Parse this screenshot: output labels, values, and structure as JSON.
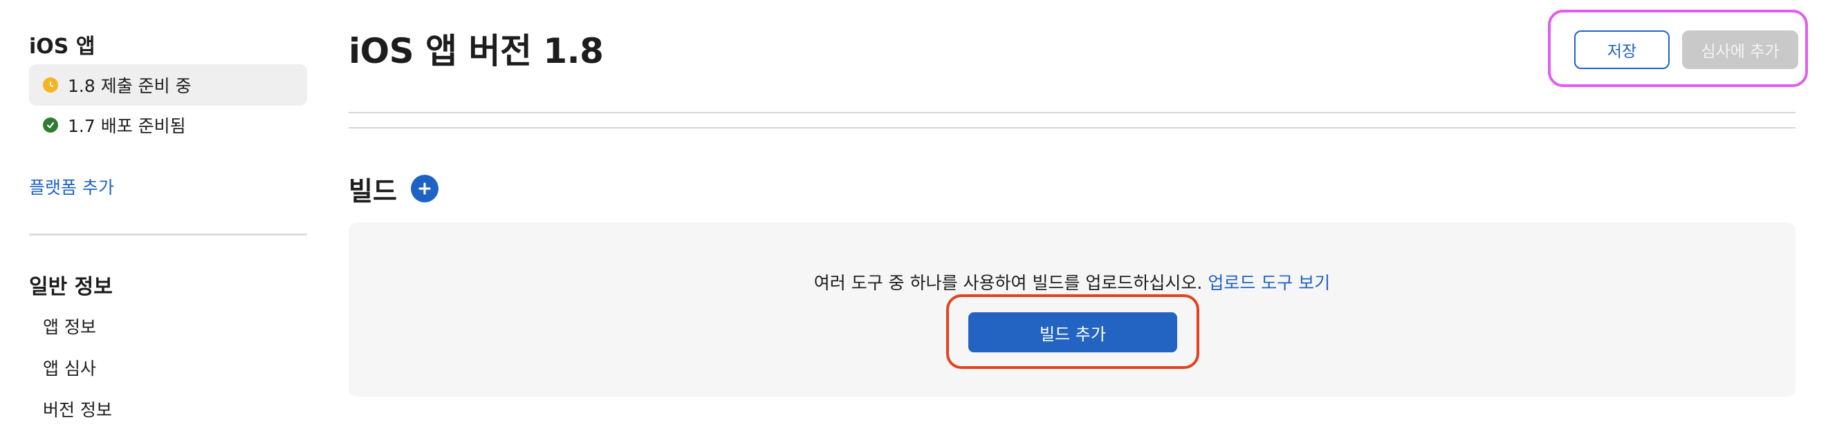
{
  "sidebar": {
    "app_heading": "iOS 앱",
    "versions": [
      {
        "label": "1.8 제출 준비 중",
        "status": "pending"
      },
      {
        "label": "1.7 배포 준비됨",
        "status": "ready"
      }
    ],
    "add_platform": "플랫폼 추가",
    "general_heading": "일반 정보",
    "general_items": [
      "앱 정보",
      "앱 심사",
      "버전 정보"
    ]
  },
  "header": {
    "title": "iOS 앱 버전 1.8",
    "save_label": "저장",
    "add_to_review_label": "심사에 추가"
  },
  "build": {
    "section_title": "빌드",
    "description": "여러 도구 중 하나를 사용하여 빌드를 업로드하십시오.",
    "link_text": "업로드 도구 보기",
    "add_button_label": "빌드 추가"
  },
  "colors": {
    "accent": "#1e63c4",
    "pending": "#f7b321",
    "ready": "#2e7d32",
    "highlight_magenta": "#e15df0",
    "highlight_red": "#e0431f"
  }
}
